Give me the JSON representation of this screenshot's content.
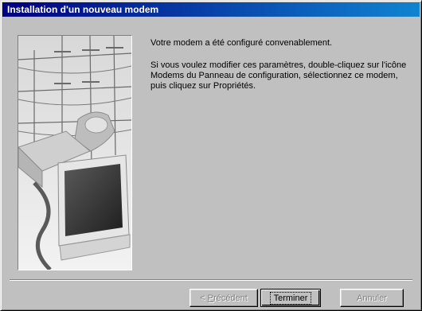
{
  "window": {
    "title": "Installation d'un nouveau modem"
  },
  "message": {
    "line1": "Votre modem a été configuré convenablement.",
    "line2": "Si vous voulez modifier ces paramètres, double-cliquez sur l'icône Modems du Panneau de configuration, sélectionnez ce modem, puis cliquez sur Propriétés."
  },
  "buttons": {
    "previous_prefix": "< ",
    "previous_mnemonic": "P",
    "previous_rest": "récédent",
    "finish_label": "Terminer",
    "cancel_label": "Annuler"
  },
  "states": {
    "previous": "disabled",
    "finish": "default",
    "cancel": "disabled"
  }
}
